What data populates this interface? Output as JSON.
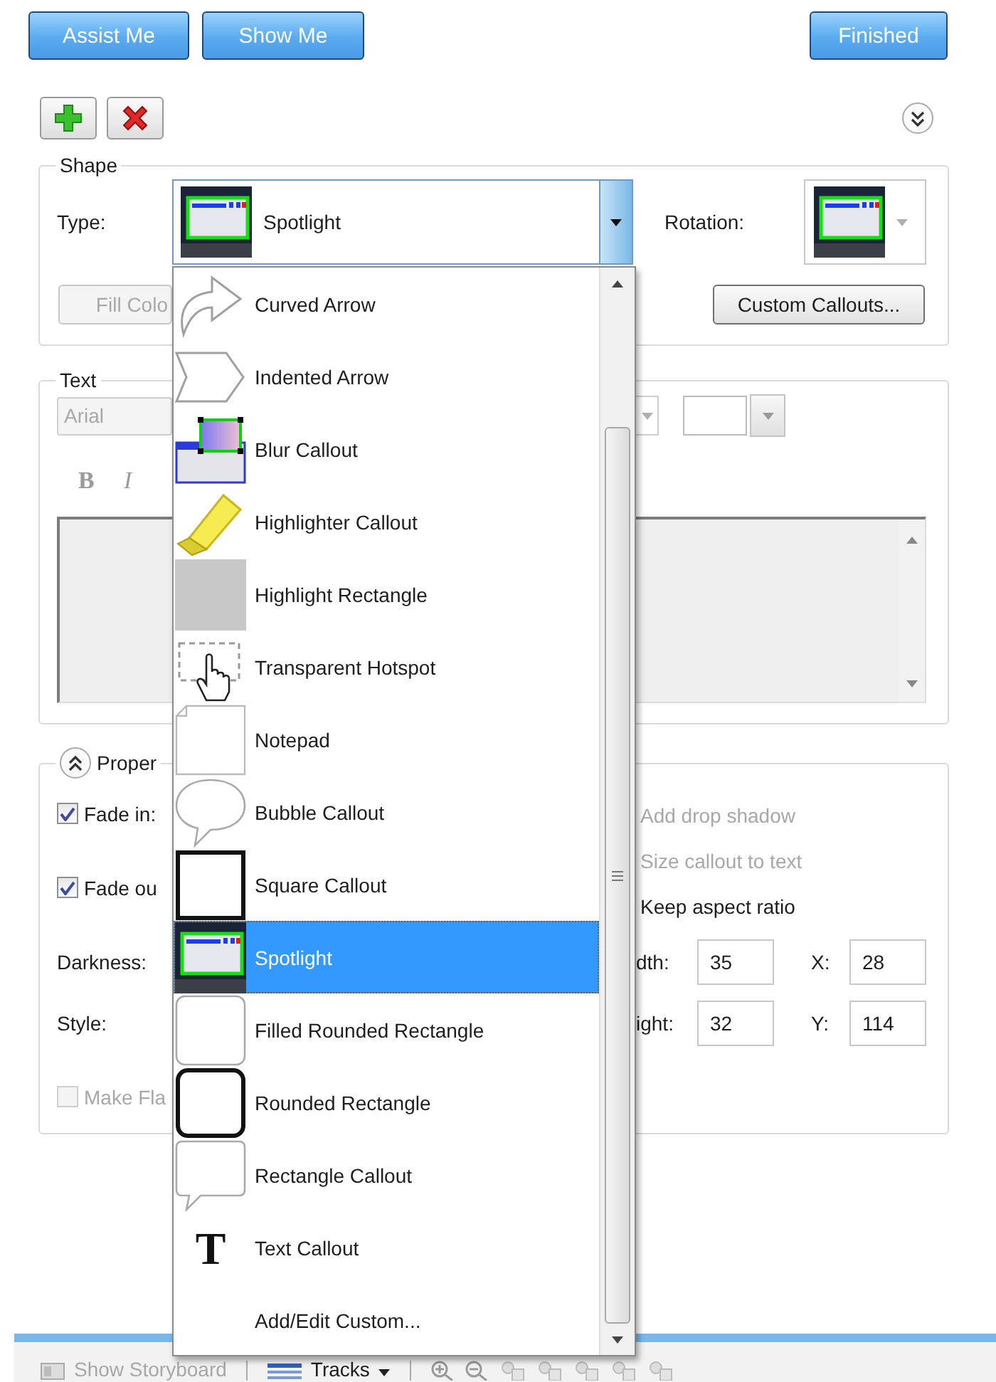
{
  "top_buttons": [
    {
      "label": "Assist Me"
    },
    {
      "label": "Show Me"
    },
    {
      "label": "Finished"
    }
  ],
  "shape": {
    "legend": "Shape",
    "type_label": "Type:",
    "type_value": "Spotlight",
    "rotation_label": "Rotation:",
    "fill_color_button": {
      "label": "Fill Colo",
      "disabled": true
    },
    "custom_callouts_button": {
      "label": "Custom Callouts...",
      "disabled": false
    }
  },
  "text": {
    "legend": "Text",
    "font": "Arial",
    "format_buttons": [
      {
        "label": "B",
        "kind": "bold"
      },
      {
        "label": "I",
        "kind": "italic"
      }
    ]
  },
  "properties": {
    "legend": "Proper",
    "checkboxes": [
      {
        "label": "Fade in:",
        "checked": true,
        "disabled": false
      },
      {
        "label": "Fade ou",
        "checked": true,
        "disabled": false
      }
    ],
    "darkness_label": "Darkness:",
    "style_label": "Style:",
    "make_flat": {
      "label": "Make Fla",
      "checked": false,
      "disabled": true
    },
    "options": [
      {
        "label": "Add drop shadow",
        "disabled": true
      },
      {
        "label": "Size callout to text",
        "disabled": true
      },
      {
        "label": "Keep aspect ratio",
        "disabled": false
      }
    ],
    "fields": [
      {
        "label": "dth:",
        "value": "35"
      },
      {
        "label": "X:",
        "value": "28"
      },
      {
        "label": "ight:",
        "value": "32"
      },
      {
        "label": "Y:",
        "value": "114"
      }
    ]
  },
  "dropdown": {
    "items": [
      {
        "label": "Curved Arrow",
        "kind": "curved-arrow",
        "selected": false
      },
      {
        "label": "Indented Arrow",
        "kind": "indented-arrow",
        "selected": false
      },
      {
        "label": "Blur Callout",
        "kind": "blur",
        "selected": false
      },
      {
        "label": "Highlighter Callout",
        "kind": "highlighter",
        "selected": false
      },
      {
        "label": "Highlight Rectangle",
        "kind": "highlight-rect",
        "selected": false
      },
      {
        "label": "Transparent Hotspot",
        "kind": "hotspot",
        "selected": false
      },
      {
        "label": "Notepad",
        "kind": "notepad",
        "selected": false
      },
      {
        "label": "Bubble Callout",
        "kind": "bubble",
        "selected": false
      },
      {
        "label": "Square Callout",
        "kind": "square",
        "selected": false
      },
      {
        "label": "Spotlight",
        "kind": "spotlight",
        "selected": true
      },
      {
        "label": "Filled Rounded Rectangle",
        "kind": "filled-rounded",
        "selected": false
      },
      {
        "label": "Rounded Rectangle",
        "kind": "rounded",
        "selected": false
      },
      {
        "label": "Rectangle Callout",
        "kind": "rect-callout",
        "selected": false
      },
      {
        "label": "Text Callout",
        "kind": "text",
        "icon_glyph": "T",
        "selected": false
      },
      {
        "label": "Add/Edit Custom...",
        "kind": "custom",
        "selected": false
      }
    ]
  },
  "bottom_toolbar": {
    "items": [
      {
        "label": "Show Storyboard",
        "disabled": true
      },
      {
        "label": "Tracks",
        "disabled": false
      }
    ]
  }
}
